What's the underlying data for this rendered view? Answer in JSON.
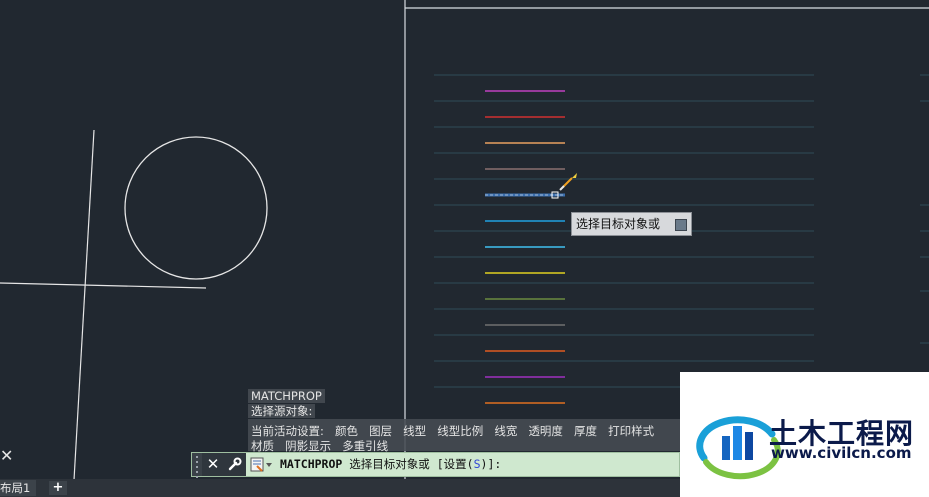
{
  "history": {
    "line1": "MATCHPROP",
    "line2": "选择源对象:",
    "line3_prefix": "当前活动设置:",
    "line3_options": [
      "颜色",
      "图层",
      "线型",
      "线型比例",
      "线宽",
      "透明度",
      "厚度",
      "打印样式"
    ],
    "line4_options": [
      "材质",
      "阴影显示",
      "多重引线"
    ]
  },
  "command_line": {
    "prefix": "MATCHPROP",
    "prompt": "选择目标对象或",
    "option_open": "[",
    "option_label": "设置(",
    "option_key": "S",
    "option_close": ")",
    "suffix": "]:",
    "close_glyph": "✕"
  },
  "tooltip": {
    "text": "选择目标对象或"
  },
  "tabs": {
    "layout1": "布局1",
    "add": "+"
  },
  "crosshair_glyph": "✕",
  "logo": {
    "name": "土木工程网",
    "url": "www.civilcn.com"
  },
  "colors": {
    "background": "#212830",
    "command_bg": "#cfe8cf",
    "line_colors": [
      "#c040c0",
      "#d03030",
      "#e8a060",
      "#8a7070",
      "#3a6fb0",
      "#20a0e0",
      "#40c0f0",
      "#e0d020",
      "#6a8a40",
      "#707070",
      "#e05a20",
      "#a030c0",
      "#e07020"
    ]
  }
}
